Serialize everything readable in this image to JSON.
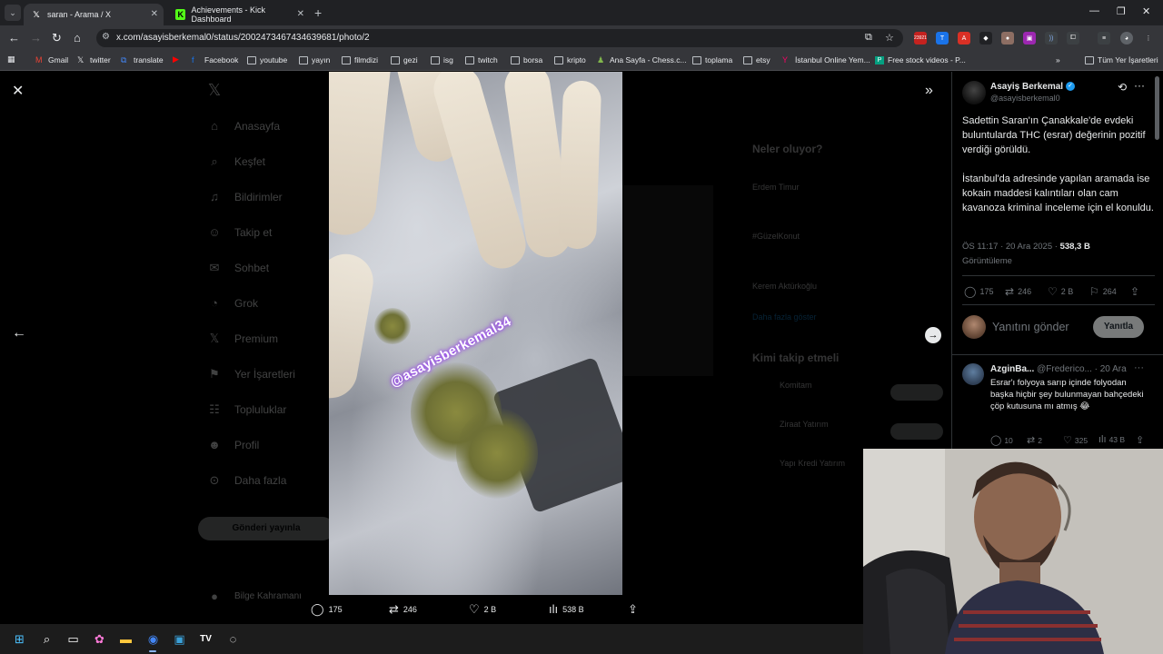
{
  "browser": {
    "tabs": [
      {
        "label": "saran - Arama / X",
        "active": true,
        "icon": "x-logo-icon"
      },
      {
        "label": "Achievements - Kick Dashboard",
        "active": false,
        "icon": "kick-logo-icon"
      }
    ],
    "url": "x.com/asayisberkemal0/status/2002473467434639681/photo/2",
    "extension_badge": "23921",
    "bookmarks": [
      "Gmail",
      "twitter",
      "translate",
      "Facebook",
      "youtube",
      "yayın",
      "filmdizi",
      "gezi",
      "isg",
      "twitch",
      "borsa",
      "kripto",
      "Ana Sayfa - Chess.c...",
      "toplama",
      "etsy",
      "İstanbul Online Yem...",
      "Free stock videos - P..."
    ],
    "bookmarks_more": "»",
    "all_bookmarks": "Tüm Yer İşaretleri"
  },
  "background_nav": [
    "Anasayfa",
    "Keşfet",
    "Bildirimler",
    "Takip et",
    "Sohbet",
    "Grok",
    "Premium",
    "Yer İşaretleri",
    "Topluluklar",
    "Profil",
    "Daha fazla"
  ],
  "background_post_button": "Gönderi yayınla",
  "background_user": "Bilge Kahramanı",
  "background_right": {
    "whats_happening": "Neler oluyor?",
    "trends": [
      "Erdem Timur",
      "#GüzelKonut",
      "Kerem Aktürkoğlu"
    ],
    "show_more": "Daha fazla göster",
    "who_to_follow": "Kimi takip etmeli",
    "suggestions": [
      "Komitam",
      "Ziraat Yatırım",
      "Yapı Kredi Yatırım"
    ],
    "follow_label": "Takip et"
  },
  "media": {
    "watermark": "@asayisberkemal34",
    "actions": {
      "replies": "175",
      "reposts": "246",
      "likes": "2 B",
      "views": "538 B"
    }
  },
  "tweet": {
    "author_name": "Asayiş Berkemal",
    "author_handle": "@asayisberkemal0",
    "paragraph1": "Sadettin Saran'ın Çanakkale'de evdeki buluntularda THC (esrar) değerinin pozitif verdiği görüldü.",
    "paragraph2": "İstanbul'da adresinde yapılan aramada ise kokain maddesi kalıntıları olan cam kavanoza kriminal inceleme için el konuldu.",
    "time": "ÖS 11:17 · 20 Ara 2025 ·",
    "views": "538,3 B",
    "views_label": "Görüntüleme",
    "stats": {
      "replies": "175",
      "reposts": "246",
      "likes": "2 B",
      "bookmarks": "264"
    }
  },
  "reply_box": {
    "placeholder": "Yanıtını gönder",
    "button": "Yanıtla"
  },
  "comment": {
    "name": "AzginBa...",
    "handle": "@Frederico...",
    "date": "· 20 Ara",
    "text": "Esrar'ı folyoya sarıp içinde folyodan başka hiçbir şey bulunmayan bahçedeki çöp kutusuna mı atmış 😂",
    "stats": {
      "replies": "10",
      "reposts": "2",
      "likes": "325",
      "views": "43 B"
    }
  },
  "colors": {
    "accent": "#1d9bf0",
    "background": "#000000",
    "muted": "#71767b"
  }
}
